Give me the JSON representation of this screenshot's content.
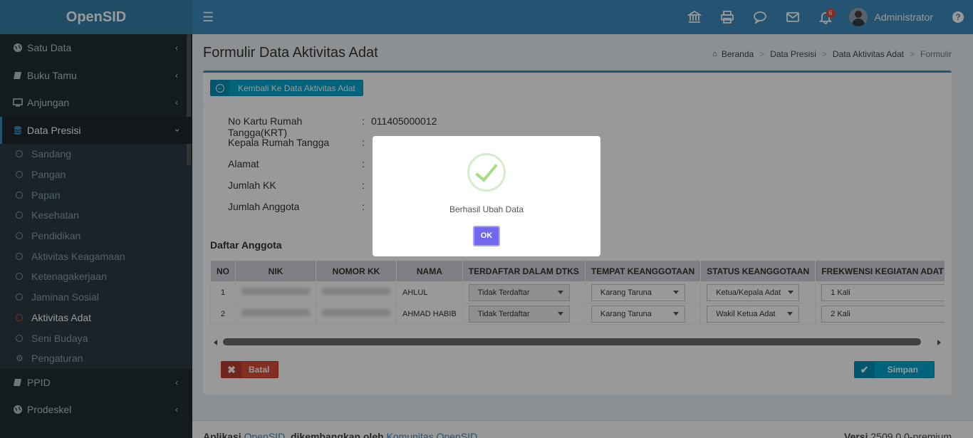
{
  "app": {
    "title": "OpenSID"
  },
  "sidebar": {
    "items": [
      {
        "label": "Satu Data",
        "icon": "globe-icon"
      },
      {
        "label": "Buku Tamu",
        "icon": "book-icon"
      },
      {
        "label": "Anjungan",
        "icon": "monitor-icon"
      },
      {
        "label": "Data Presisi",
        "icon": "database-icon"
      }
    ],
    "sub": [
      {
        "label": "Sandang"
      },
      {
        "label": "Pangan"
      },
      {
        "label": "Papan"
      },
      {
        "label": "Kesehatan"
      },
      {
        "label": "Pendidikan"
      },
      {
        "label": "Aktivitas Keagamaan"
      },
      {
        "label": "Ketenagakerjaan"
      },
      {
        "label": "Jaminan Sosial"
      },
      {
        "label": "Aktivitas Adat"
      },
      {
        "label": "Seni Budaya"
      },
      {
        "label": "Pengaturan"
      }
    ],
    "bottom": [
      {
        "label": "PPID",
        "icon": "book-icon"
      },
      {
        "label": "Prodeskel",
        "icon": "globe-icon"
      }
    ]
  },
  "header": {
    "username": "Administrator",
    "notif_count": "6"
  },
  "page": {
    "title": "Formulir Data Aktivitas Adat",
    "breadcrumb": [
      "Beranda",
      "Data Presisi",
      "Data Aktivitas Adat",
      "Formulir"
    ],
    "back_label": "Kembali Ke Data Aktivitas Adat",
    "info": [
      {
        "label": "No Kartu Rumah Tangga(KRT)",
        "sep": ":",
        "value": "011405000012"
      },
      {
        "label": "Kepala Rumah Tangga",
        "sep": ":",
        "value": ""
      },
      {
        "label": "Alamat",
        "sep": ":",
        "value": ""
      },
      {
        "label": "Jumlah KK",
        "sep": ":",
        "value": ""
      },
      {
        "label": "Jumlah Anggota",
        "sep": ":",
        "value": ""
      }
    ],
    "section_title": "Daftar Anggota",
    "table": {
      "headers": [
        "NO",
        "NIK",
        "NOMOR KK",
        "NAMA",
        "TERDAFTAR DALAM DTKS",
        "TEMPAT KEANGGOTAAN",
        "STATUS KEANGGOTAAN",
        "FREKWENSI KEGIATAN ADAT YANG DIIKUTI"
      ],
      "rows": [
        {
          "no": "1",
          "nama": "AHLUL",
          "dtks": "Tidak Terdaftar",
          "tempat": "Karang Taruna",
          "status": "Ketua/Kepala Adat",
          "frekwensi": "1 Kali"
        },
        {
          "no": "2",
          "nama": "AHMAD HABIB",
          "dtks": "Tidak Terdaftar",
          "tempat": "Karang Taruna",
          "status": "Wakil Ketua Adat",
          "frekwensi": "2 Kali"
        }
      ]
    },
    "batal_label": "Batal",
    "simpan_label": "Simpan"
  },
  "footer": {
    "app_prefix": "Aplikasi",
    "app_link": "OpenSID",
    "dev_text": ", dikembangkan oleh",
    "dev_link": "Komunitas OpenSID",
    "version_label": "Versi",
    "version": "2509.0.0-premium"
  },
  "modal": {
    "message": "Berhasil Ubah Data",
    "ok_label": "OK"
  },
  "colors": {
    "primary": "#3c8dbc",
    "danger": "#dd4b39",
    "info": "#00a7d0",
    "success_check": "#a5dc86",
    "ok_button": "#7267ef"
  }
}
